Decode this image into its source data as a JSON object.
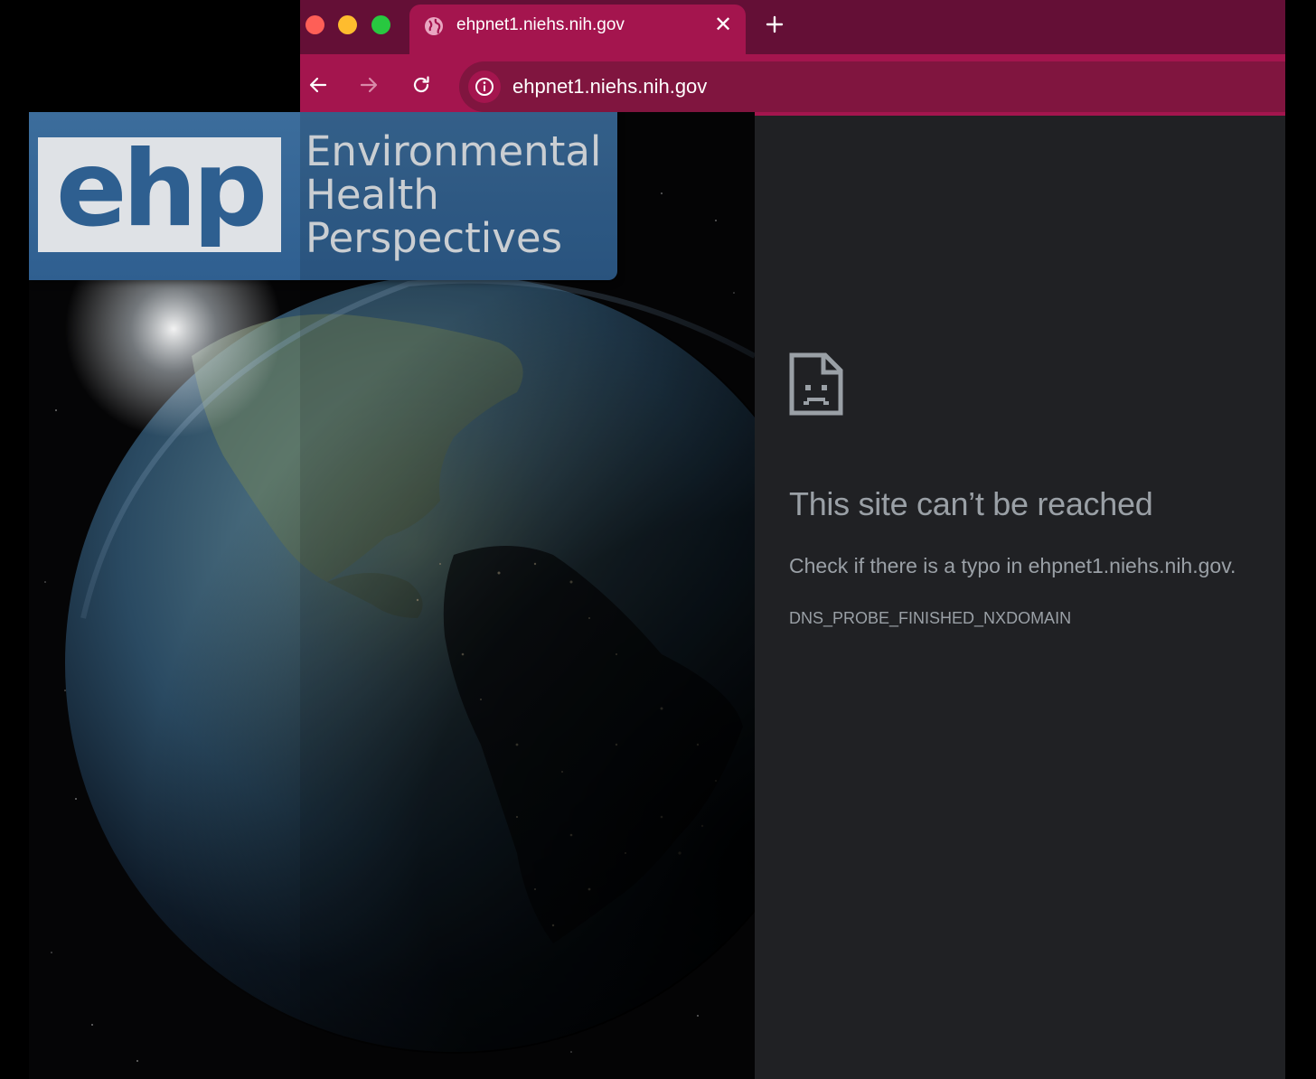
{
  "browser": {
    "tab": {
      "title": "ehpnet1.niehs.nih.gov",
      "close_label": "✕"
    },
    "address_bar": {
      "url": "ehpnet1.niehs.nih.gov"
    },
    "colors": {
      "tabstrip": "#640f36",
      "toolbar": "#a4154e",
      "page_background": "#202124",
      "error_text": "#9aa0a6"
    }
  },
  "error": {
    "title": "This site can’t be reached",
    "detail": "Check if there is a typo in ehpnet1.niehs.nih.gov.",
    "code": "DNS_PROBE_FINISHED_NXDOMAIN"
  },
  "journal_cover": {
    "logo_text": "ehp",
    "name_lines": [
      "Environmental",
      "Health",
      "Perspectives"
    ],
    "colors": {
      "banner": "#3c6d9c",
      "logo_box": "#dfe2e6",
      "logo_text": "#2e5f90"
    }
  }
}
